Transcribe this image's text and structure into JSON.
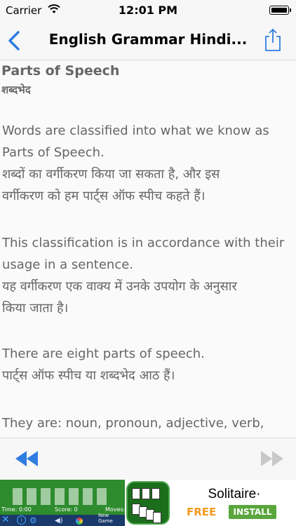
{
  "status_bar": {
    "carrier": "Carrier",
    "time": "12:01 PM"
  },
  "nav": {
    "title": "English Grammar Hindi...",
    "back_icon": "chevron-left-icon",
    "share_icon": "share-icon"
  },
  "article": {
    "heading": "Parts of Speech",
    "subheading": "शब्दभेद",
    "paragraphs": [
      {
        "lines": [
          "Words are classified into what we know as",
          "Parts of Speech.",
          "शब्दों का वर्गीकरण किया जा सकता है, और इस",
          "वर्गीकरण को हम पार्ट्स ऑफ स्पीच कहते हैं।"
        ]
      },
      {
        "lines": [
          "This classification is in accordance with their",
          "usage in a sentence.",
          "यह वर्गीकरण एक वाक्य में उनके उपयोग के अनुसार",
          "किया जाता है।"
        ]
      },
      {
        "lines": [
          "There are eight parts of speech.",
          "पार्ट्स ऑफ स्पीच या शब्दभेद आठ हैं।"
        ]
      },
      {
        "lines": [
          "They are: noun, pronoun, adjective, verb,"
        ]
      }
    ]
  },
  "toolbar": {
    "rewind_icon": "rewind-icon",
    "forward_icon": "fast-forward-icon"
  },
  "ad": {
    "game_labels": [
      "Time: 0:00",
      "Score: 0",
      "Moves:"
    ],
    "new_game": "New Game",
    "app_title": "Solitaire·",
    "price": "FREE",
    "install_label": "INSTALL"
  },
  "colors": {
    "accent_blue": "#2f7de1",
    "ad_green": "#2e8b2e",
    "free_orange": "#f29b1e",
    "install_green": "#5aa63d"
  }
}
